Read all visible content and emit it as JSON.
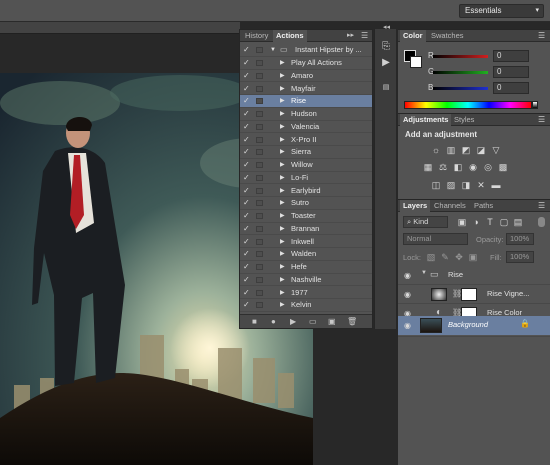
{
  "workspace": {
    "selected": "Essentials"
  },
  "actions_panel": {
    "tabs": [
      "History",
      "Actions"
    ],
    "set_name": "Instant Hipster by ...",
    "items": [
      "Play All Actions",
      "Amaro",
      "Mayfair",
      "Rise",
      "Hudson",
      "Valencia",
      "X-Pro II",
      "Sierra",
      "Willow",
      "Lo-Fi",
      "Earlybird",
      "Sutro",
      "Toaster",
      "Brannan",
      "Inkwell",
      "Walden",
      "Hefe",
      "Nashville",
      "1977",
      "Kelvin"
    ],
    "selected": "Rise",
    "check_glyph": "✓"
  },
  "color_panel": {
    "tabs": [
      "Color",
      "Swatches"
    ],
    "channels": [
      {
        "label": "R",
        "value": "0",
        "color": "#d02020"
      },
      {
        "label": "G",
        "value": "0",
        "color": "#20b020"
      },
      {
        "label": "B",
        "value": "0",
        "color": "#2030d0"
      }
    ]
  },
  "adjustments_panel": {
    "tabs": [
      "Adjustments",
      "Styles"
    ],
    "heading": "Add an adjustment"
  },
  "layers_panel": {
    "tabs": [
      "Layers",
      "Channels",
      "Paths"
    ],
    "filter_kind": "Kind",
    "blend_mode": "Normal",
    "opacity_label": "Opacity:",
    "opacity_value": "100%",
    "lock_label": "Lock:",
    "fill_label": "Fill:",
    "fill_value": "100%",
    "layers": [
      {
        "name": "Rise"
      },
      {
        "name": "Rise Vigne..."
      },
      {
        "name": "Rise Color"
      },
      {
        "name": "Background"
      }
    ]
  },
  "colors": {
    "selection": "#6a7fa0",
    "panel": "#535353"
  }
}
